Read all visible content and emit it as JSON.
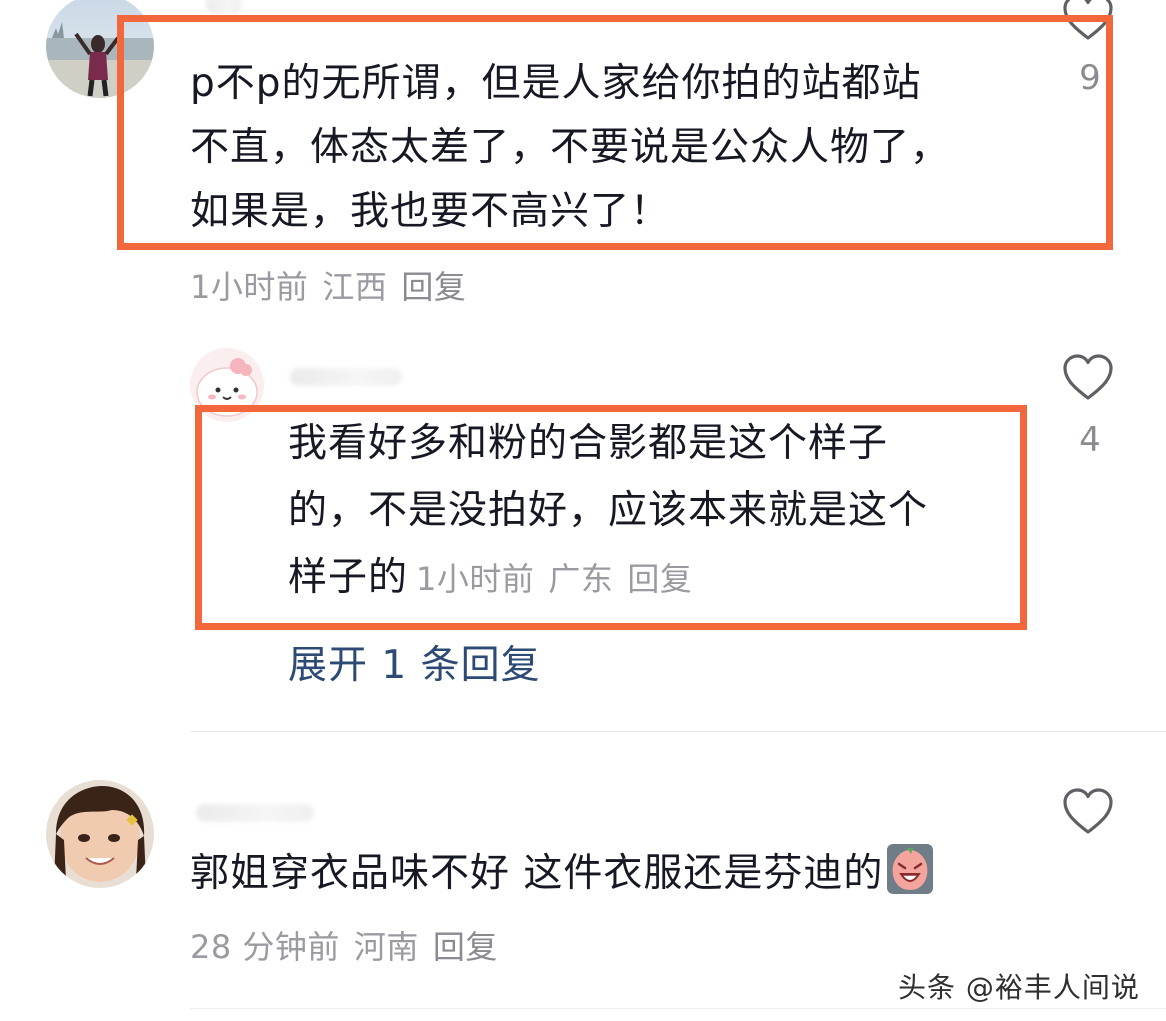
{
  "comments": [
    {
      "text_lines": [
        "p不p的无所谓，但是人家给你拍的站都站",
        "不直，体态太差了，不要说是公众人物了，",
        "如果是，我也要不高兴了！"
      ],
      "time": "1小时前",
      "location": "江西",
      "reply_label": "回复",
      "likes": "9"
    },
    {
      "text_lines": [
        "我看好多和粉的合影都是这个样子",
        "的，不是没拍好，应该本来就是这个",
        "样子的"
      ],
      "time": "1小时前",
      "location": "广东",
      "reply_label": "回复",
      "likes": "4",
      "expand_label": "展开 1 条回复"
    },
    {
      "text": "郭姐穿衣品味不好 这件衣服还是芬迪的",
      "emoji": "crying-face-emoji",
      "time": "28 分钟前",
      "location": "河南",
      "reply_label": "回复"
    }
  ],
  "watermark": "头条 @裕丰人间说",
  "colors": {
    "highlight": "#f2683c",
    "text": "#161823",
    "meta": "#9a9ba1",
    "expand": "#2c4a74"
  }
}
